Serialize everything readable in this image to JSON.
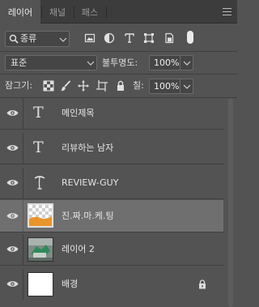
{
  "tabs": [
    {
      "label": "레이어",
      "active": true
    },
    {
      "label": "채널",
      "active": false
    },
    {
      "label": "패스",
      "active": false
    }
  ],
  "filter": {
    "kind_label": "종류",
    "icons": [
      "image-filter-icon",
      "adjustment-filter-icon",
      "type-filter-icon",
      "shape-filter-icon",
      "smart-object-filter-icon"
    ]
  },
  "blend": {
    "mode": "표준",
    "opacity_label": "불투명도:",
    "opacity_value": "100%"
  },
  "lock": {
    "label": "잠그기:",
    "icons": [
      "lock-transparent-icon",
      "lock-image-icon",
      "lock-position-icon",
      "lock-artboard-icon",
      "lock-all-icon"
    ],
    "fill_label": "칠:",
    "fill_value": "100%"
  },
  "layers": [
    {
      "name": "메인제목",
      "kind": "type",
      "visible": true,
      "selected": false
    },
    {
      "name": "리뷰하는 남자",
      "kind": "type",
      "visible": true,
      "selected": false
    },
    {
      "name": "REVIEW-GUY",
      "kind": "warped-type",
      "visible": true,
      "selected": false
    },
    {
      "name": "진.짜.마.케.팅",
      "kind": "pixel",
      "visible": true,
      "selected": true
    },
    {
      "name": "레이어 2",
      "kind": "pixel",
      "visible": true,
      "selected": false
    },
    {
      "name": "배경",
      "kind": "background",
      "visible": true,
      "selected": false,
      "locked": true
    }
  ],
  "colors": {
    "panel_bg": "#535353",
    "selected_row": "#6f6f6f",
    "orange_fill": "#e8952c"
  }
}
